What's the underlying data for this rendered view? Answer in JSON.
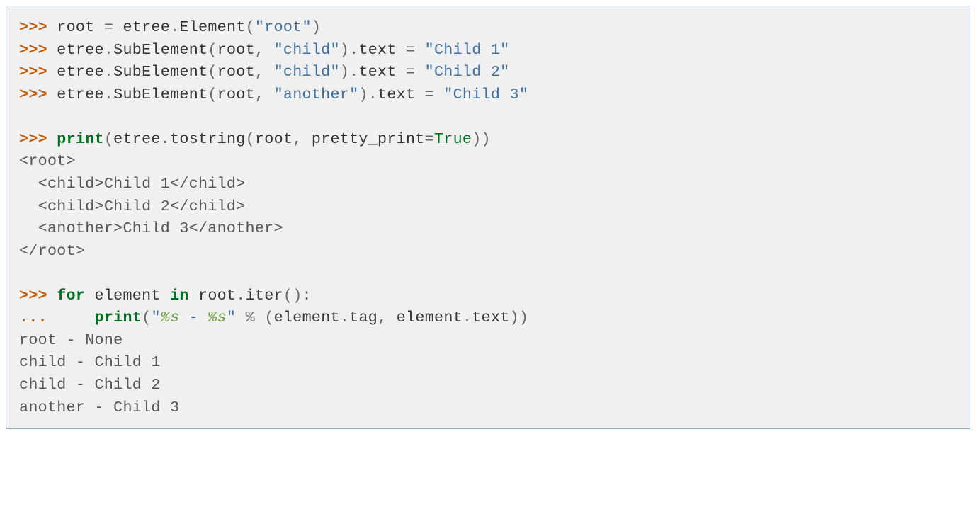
{
  "lines": [
    {
      "type": "code",
      "segments": [
        {
          "cls": "prompt",
          "text": ">>> "
        },
        {
          "cls": "text",
          "text": "root "
        },
        {
          "cls": "punct",
          "text": "="
        },
        {
          "cls": "text",
          "text": " etree"
        },
        {
          "cls": "punct",
          "text": "."
        },
        {
          "cls": "text",
          "text": "Element"
        },
        {
          "cls": "punct",
          "text": "("
        },
        {
          "cls": "string",
          "text": "\"root\""
        },
        {
          "cls": "punct",
          "text": ")"
        }
      ]
    },
    {
      "type": "code",
      "segments": [
        {
          "cls": "prompt",
          "text": ">>> "
        },
        {
          "cls": "text",
          "text": "etree"
        },
        {
          "cls": "punct",
          "text": "."
        },
        {
          "cls": "text",
          "text": "SubElement"
        },
        {
          "cls": "punct",
          "text": "("
        },
        {
          "cls": "text",
          "text": "root"
        },
        {
          "cls": "punct",
          "text": ","
        },
        {
          "cls": "text",
          "text": " "
        },
        {
          "cls": "string",
          "text": "\"child\""
        },
        {
          "cls": "punct",
          "text": ")."
        },
        {
          "cls": "text",
          "text": "text "
        },
        {
          "cls": "punct",
          "text": "="
        },
        {
          "cls": "text",
          "text": " "
        },
        {
          "cls": "string",
          "text": "\"Child 1\""
        }
      ]
    },
    {
      "type": "code",
      "segments": [
        {
          "cls": "prompt",
          "text": ">>> "
        },
        {
          "cls": "text",
          "text": "etree"
        },
        {
          "cls": "punct",
          "text": "."
        },
        {
          "cls": "text",
          "text": "SubElement"
        },
        {
          "cls": "punct",
          "text": "("
        },
        {
          "cls": "text",
          "text": "root"
        },
        {
          "cls": "punct",
          "text": ","
        },
        {
          "cls": "text",
          "text": " "
        },
        {
          "cls": "string",
          "text": "\"child\""
        },
        {
          "cls": "punct",
          "text": ")."
        },
        {
          "cls": "text",
          "text": "text "
        },
        {
          "cls": "punct",
          "text": "="
        },
        {
          "cls": "text",
          "text": " "
        },
        {
          "cls": "string",
          "text": "\"Child 2\""
        }
      ]
    },
    {
      "type": "code",
      "segments": [
        {
          "cls": "prompt",
          "text": ">>> "
        },
        {
          "cls": "text",
          "text": "etree"
        },
        {
          "cls": "punct",
          "text": "."
        },
        {
          "cls": "text",
          "text": "SubElement"
        },
        {
          "cls": "punct",
          "text": "("
        },
        {
          "cls": "text",
          "text": "root"
        },
        {
          "cls": "punct",
          "text": ","
        },
        {
          "cls": "text",
          "text": " "
        },
        {
          "cls": "string",
          "text": "\"another\""
        },
        {
          "cls": "punct",
          "text": ")."
        },
        {
          "cls": "text",
          "text": "text "
        },
        {
          "cls": "punct",
          "text": "="
        },
        {
          "cls": "text",
          "text": " "
        },
        {
          "cls": "string",
          "text": "\"Child 3\""
        }
      ]
    },
    {
      "type": "blank"
    },
    {
      "type": "code",
      "segments": [
        {
          "cls": "prompt",
          "text": ">>> "
        },
        {
          "cls": "keyword",
          "text": "print"
        },
        {
          "cls": "punct",
          "text": "("
        },
        {
          "cls": "text",
          "text": "etree"
        },
        {
          "cls": "punct",
          "text": "."
        },
        {
          "cls": "text",
          "text": "tostring"
        },
        {
          "cls": "punct",
          "text": "("
        },
        {
          "cls": "text",
          "text": "root"
        },
        {
          "cls": "punct",
          "text": ","
        },
        {
          "cls": "text",
          "text": " pretty_print"
        },
        {
          "cls": "punct",
          "text": "="
        },
        {
          "cls": "const",
          "text": "True"
        },
        {
          "cls": "punct",
          "text": "))"
        }
      ]
    },
    {
      "type": "output",
      "text": "<root>"
    },
    {
      "type": "output",
      "text": "  <child>Child 1</child>"
    },
    {
      "type": "output",
      "text": "  <child>Child 2</child>"
    },
    {
      "type": "output",
      "text": "  <another>Child 3</another>"
    },
    {
      "type": "output",
      "text": "</root>"
    },
    {
      "type": "blank"
    },
    {
      "type": "code",
      "segments": [
        {
          "cls": "prompt",
          "text": ">>> "
        },
        {
          "cls": "keyword",
          "text": "for"
        },
        {
          "cls": "text",
          "text": " element "
        },
        {
          "cls": "keyword",
          "text": "in"
        },
        {
          "cls": "text",
          "text": " root"
        },
        {
          "cls": "punct",
          "text": "."
        },
        {
          "cls": "text",
          "text": "iter"
        },
        {
          "cls": "punct",
          "text": "():"
        }
      ]
    },
    {
      "type": "code",
      "segments": [
        {
          "cls": "continuation",
          "text": "... "
        },
        {
          "cls": "text",
          "text": "    "
        },
        {
          "cls": "keyword",
          "text": "print"
        },
        {
          "cls": "punct",
          "text": "("
        },
        {
          "cls": "string",
          "text": "\""
        },
        {
          "cls": "fmt",
          "text": "%s"
        },
        {
          "cls": "string",
          "text": " - "
        },
        {
          "cls": "fmt",
          "text": "%s"
        },
        {
          "cls": "string",
          "text": "\""
        },
        {
          "cls": "text",
          "text": " "
        },
        {
          "cls": "punct",
          "text": "%"
        },
        {
          "cls": "text",
          "text": " "
        },
        {
          "cls": "punct",
          "text": "("
        },
        {
          "cls": "text",
          "text": "element"
        },
        {
          "cls": "punct",
          "text": "."
        },
        {
          "cls": "text",
          "text": "tag"
        },
        {
          "cls": "punct",
          "text": ","
        },
        {
          "cls": "text",
          "text": " element"
        },
        {
          "cls": "punct",
          "text": "."
        },
        {
          "cls": "text",
          "text": "text"
        },
        {
          "cls": "punct",
          "text": "))"
        }
      ]
    },
    {
      "type": "output",
      "text": "root - None"
    },
    {
      "type": "output",
      "text": "child - Child 1"
    },
    {
      "type": "output",
      "text": "child - Child 2"
    },
    {
      "type": "output",
      "text": "another - Child 3"
    }
  ]
}
